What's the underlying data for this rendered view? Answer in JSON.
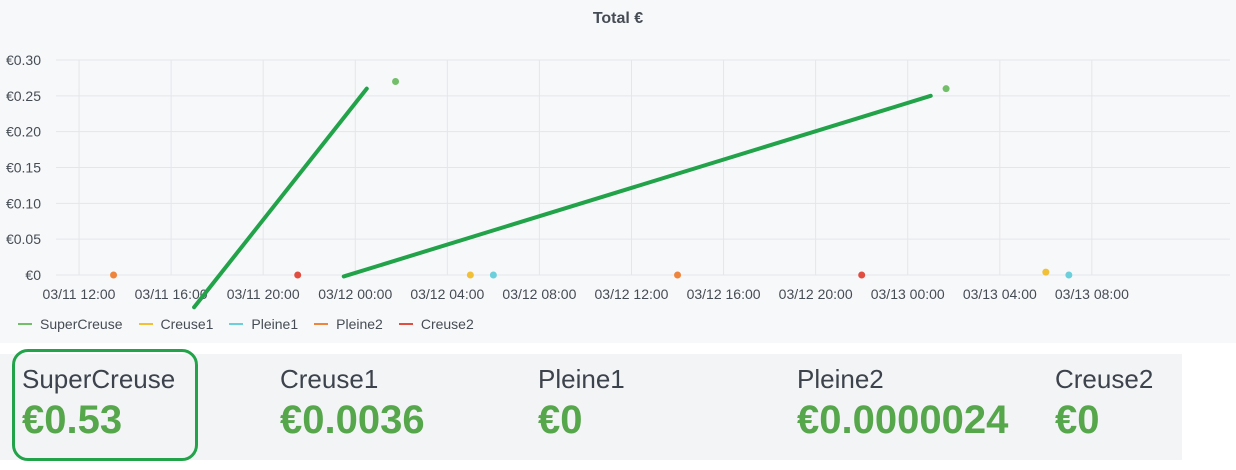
{
  "chart_data": {
    "type": "line",
    "title": "Total €",
    "x_ticks": [
      "03/11 12:00",
      "03/11 16:00",
      "03/11 20:00",
      "03/12 00:00",
      "03/12 04:00",
      "03/12 08:00",
      "03/12 12:00",
      "03/12 16:00",
      "03/12 20:00",
      "03/13 00:00",
      "03/13 04:00",
      "03/13 08:00"
    ],
    "y_ticks": [
      "€0",
      "€0.05",
      "€0.10",
      "€0.15",
      "€0.20",
      "€0.25",
      "€0.30"
    ],
    "xlim": [
      "2024-03-11 11:00",
      "2024-03-13 14:00"
    ],
    "ylim": [
      0,
      0.3
    ],
    "grid": true,
    "legend_position": "bottom-left",
    "series": [
      {
        "name": "SuperCreuse",
        "color": "#73bf69",
        "points": [
          {
            "x": "2024-03-12 01:45",
            "y": 0.27
          },
          {
            "x": "2024-03-13 01:40",
            "y": 0.26
          }
        ]
      },
      {
        "name": "Creuse1",
        "color": "#f2c037",
        "points": [
          {
            "x": "2024-03-12 05:00",
            "y": 0
          },
          {
            "x": "2024-03-13 06:00",
            "y": 0.004
          }
        ]
      },
      {
        "name": "Pleine1",
        "color": "#6ccfdc",
        "points": [
          {
            "x": "2024-03-12 06:00",
            "y": 0
          },
          {
            "x": "2024-03-13 07:00",
            "y": 0
          }
        ]
      },
      {
        "name": "Pleine2",
        "color": "#ef843c",
        "points": [
          {
            "x": "2024-03-11 13:30",
            "y": 0
          },
          {
            "x": "2024-03-12 14:00",
            "y": 0
          }
        ]
      },
      {
        "name": "Creuse2",
        "color": "#e24d42",
        "points": [
          {
            "x": "2024-03-11 21:30",
            "y": 0
          },
          {
            "x": "2024-03-12 22:00",
            "y": 0
          }
        ]
      }
    ],
    "annotations": [
      {
        "type": "drawn-line",
        "color": "#22a34a",
        "from": {
          "x": "2024-03-11 17:00",
          "y": -0.045
        },
        "to": {
          "x": "2024-03-12 00:30",
          "y": 0.26
        }
      },
      {
        "type": "drawn-line",
        "color": "#22a34a",
        "from": {
          "x": "2024-03-11 23:30",
          "y": -0.002
        },
        "to": {
          "x": "2024-03-13 01:00",
          "y": 0.25
        }
      }
    ]
  },
  "stats": [
    {
      "label": "SuperCreuse",
      "value": "€0.53"
    },
    {
      "label": "Creuse1",
      "value": "€0.0036"
    },
    {
      "label": "Pleine1",
      "value": "€0"
    },
    {
      "label": "Pleine2",
      "value": "€0.0000024"
    },
    {
      "label": "Creuse2",
      "value": "€0"
    }
  ]
}
